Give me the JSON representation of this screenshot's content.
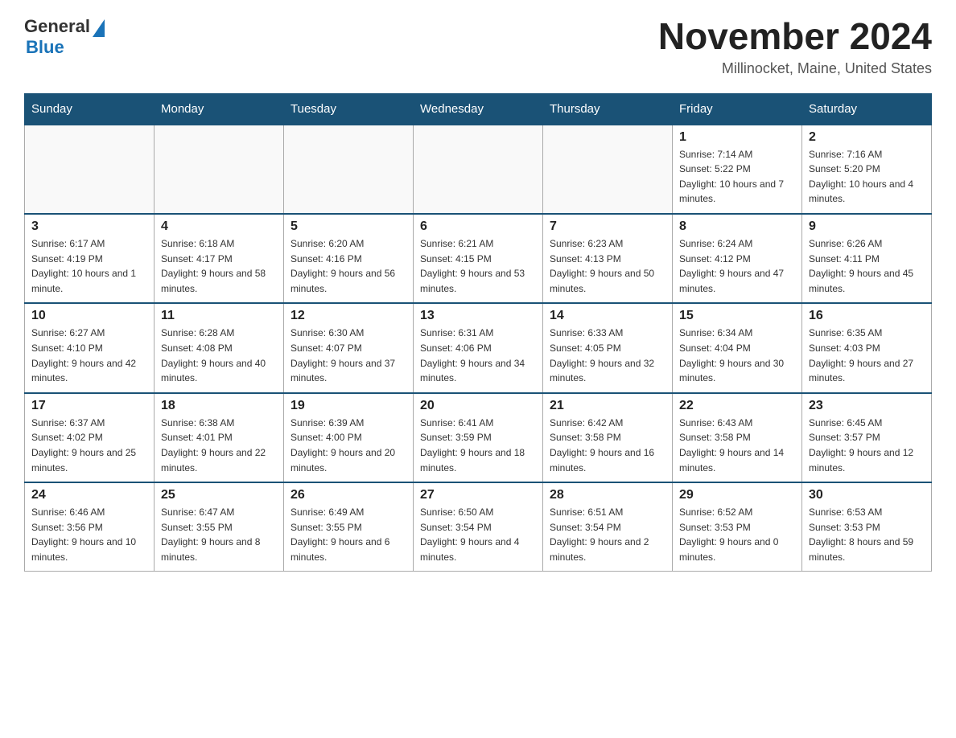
{
  "logo": {
    "general": "General",
    "triangle": "▶",
    "blue": "Blue"
  },
  "title": {
    "month_year": "November 2024",
    "location": "Millinocket, Maine, United States"
  },
  "days_header": [
    "Sunday",
    "Monday",
    "Tuesday",
    "Wednesday",
    "Thursday",
    "Friday",
    "Saturday"
  ],
  "weeks": [
    [
      {
        "day": "",
        "info": ""
      },
      {
        "day": "",
        "info": ""
      },
      {
        "day": "",
        "info": ""
      },
      {
        "day": "",
        "info": ""
      },
      {
        "day": "",
        "info": ""
      },
      {
        "day": "1",
        "info": "Sunrise: 7:14 AM\nSunset: 5:22 PM\nDaylight: 10 hours and 7 minutes."
      },
      {
        "day": "2",
        "info": "Sunrise: 7:16 AM\nSunset: 5:20 PM\nDaylight: 10 hours and 4 minutes."
      }
    ],
    [
      {
        "day": "3",
        "info": "Sunrise: 6:17 AM\nSunset: 4:19 PM\nDaylight: 10 hours and 1 minute."
      },
      {
        "day": "4",
        "info": "Sunrise: 6:18 AM\nSunset: 4:17 PM\nDaylight: 9 hours and 58 minutes."
      },
      {
        "day": "5",
        "info": "Sunrise: 6:20 AM\nSunset: 4:16 PM\nDaylight: 9 hours and 56 minutes."
      },
      {
        "day": "6",
        "info": "Sunrise: 6:21 AM\nSunset: 4:15 PM\nDaylight: 9 hours and 53 minutes."
      },
      {
        "day": "7",
        "info": "Sunrise: 6:23 AM\nSunset: 4:13 PM\nDaylight: 9 hours and 50 minutes."
      },
      {
        "day": "8",
        "info": "Sunrise: 6:24 AM\nSunset: 4:12 PM\nDaylight: 9 hours and 47 minutes."
      },
      {
        "day": "9",
        "info": "Sunrise: 6:26 AM\nSunset: 4:11 PM\nDaylight: 9 hours and 45 minutes."
      }
    ],
    [
      {
        "day": "10",
        "info": "Sunrise: 6:27 AM\nSunset: 4:10 PM\nDaylight: 9 hours and 42 minutes."
      },
      {
        "day": "11",
        "info": "Sunrise: 6:28 AM\nSunset: 4:08 PM\nDaylight: 9 hours and 40 minutes."
      },
      {
        "day": "12",
        "info": "Sunrise: 6:30 AM\nSunset: 4:07 PM\nDaylight: 9 hours and 37 minutes."
      },
      {
        "day": "13",
        "info": "Sunrise: 6:31 AM\nSunset: 4:06 PM\nDaylight: 9 hours and 34 minutes."
      },
      {
        "day": "14",
        "info": "Sunrise: 6:33 AM\nSunset: 4:05 PM\nDaylight: 9 hours and 32 minutes."
      },
      {
        "day": "15",
        "info": "Sunrise: 6:34 AM\nSunset: 4:04 PM\nDaylight: 9 hours and 30 minutes."
      },
      {
        "day": "16",
        "info": "Sunrise: 6:35 AM\nSunset: 4:03 PM\nDaylight: 9 hours and 27 minutes."
      }
    ],
    [
      {
        "day": "17",
        "info": "Sunrise: 6:37 AM\nSunset: 4:02 PM\nDaylight: 9 hours and 25 minutes."
      },
      {
        "day": "18",
        "info": "Sunrise: 6:38 AM\nSunset: 4:01 PM\nDaylight: 9 hours and 22 minutes."
      },
      {
        "day": "19",
        "info": "Sunrise: 6:39 AM\nSunset: 4:00 PM\nDaylight: 9 hours and 20 minutes."
      },
      {
        "day": "20",
        "info": "Sunrise: 6:41 AM\nSunset: 3:59 PM\nDaylight: 9 hours and 18 minutes."
      },
      {
        "day": "21",
        "info": "Sunrise: 6:42 AM\nSunset: 3:58 PM\nDaylight: 9 hours and 16 minutes."
      },
      {
        "day": "22",
        "info": "Sunrise: 6:43 AM\nSunset: 3:58 PM\nDaylight: 9 hours and 14 minutes."
      },
      {
        "day": "23",
        "info": "Sunrise: 6:45 AM\nSunset: 3:57 PM\nDaylight: 9 hours and 12 minutes."
      }
    ],
    [
      {
        "day": "24",
        "info": "Sunrise: 6:46 AM\nSunset: 3:56 PM\nDaylight: 9 hours and 10 minutes."
      },
      {
        "day": "25",
        "info": "Sunrise: 6:47 AM\nSunset: 3:55 PM\nDaylight: 9 hours and 8 minutes."
      },
      {
        "day": "26",
        "info": "Sunrise: 6:49 AM\nSunset: 3:55 PM\nDaylight: 9 hours and 6 minutes."
      },
      {
        "day": "27",
        "info": "Sunrise: 6:50 AM\nSunset: 3:54 PM\nDaylight: 9 hours and 4 minutes."
      },
      {
        "day": "28",
        "info": "Sunrise: 6:51 AM\nSunset: 3:54 PM\nDaylight: 9 hours and 2 minutes."
      },
      {
        "day": "29",
        "info": "Sunrise: 6:52 AM\nSunset: 3:53 PM\nDaylight: 9 hours and 0 minutes."
      },
      {
        "day": "30",
        "info": "Sunrise: 6:53 AM\nSunset: 3:53 PM\nDaylight: 8 hours and 59 minutes."
      }
    ]
  ]
}
